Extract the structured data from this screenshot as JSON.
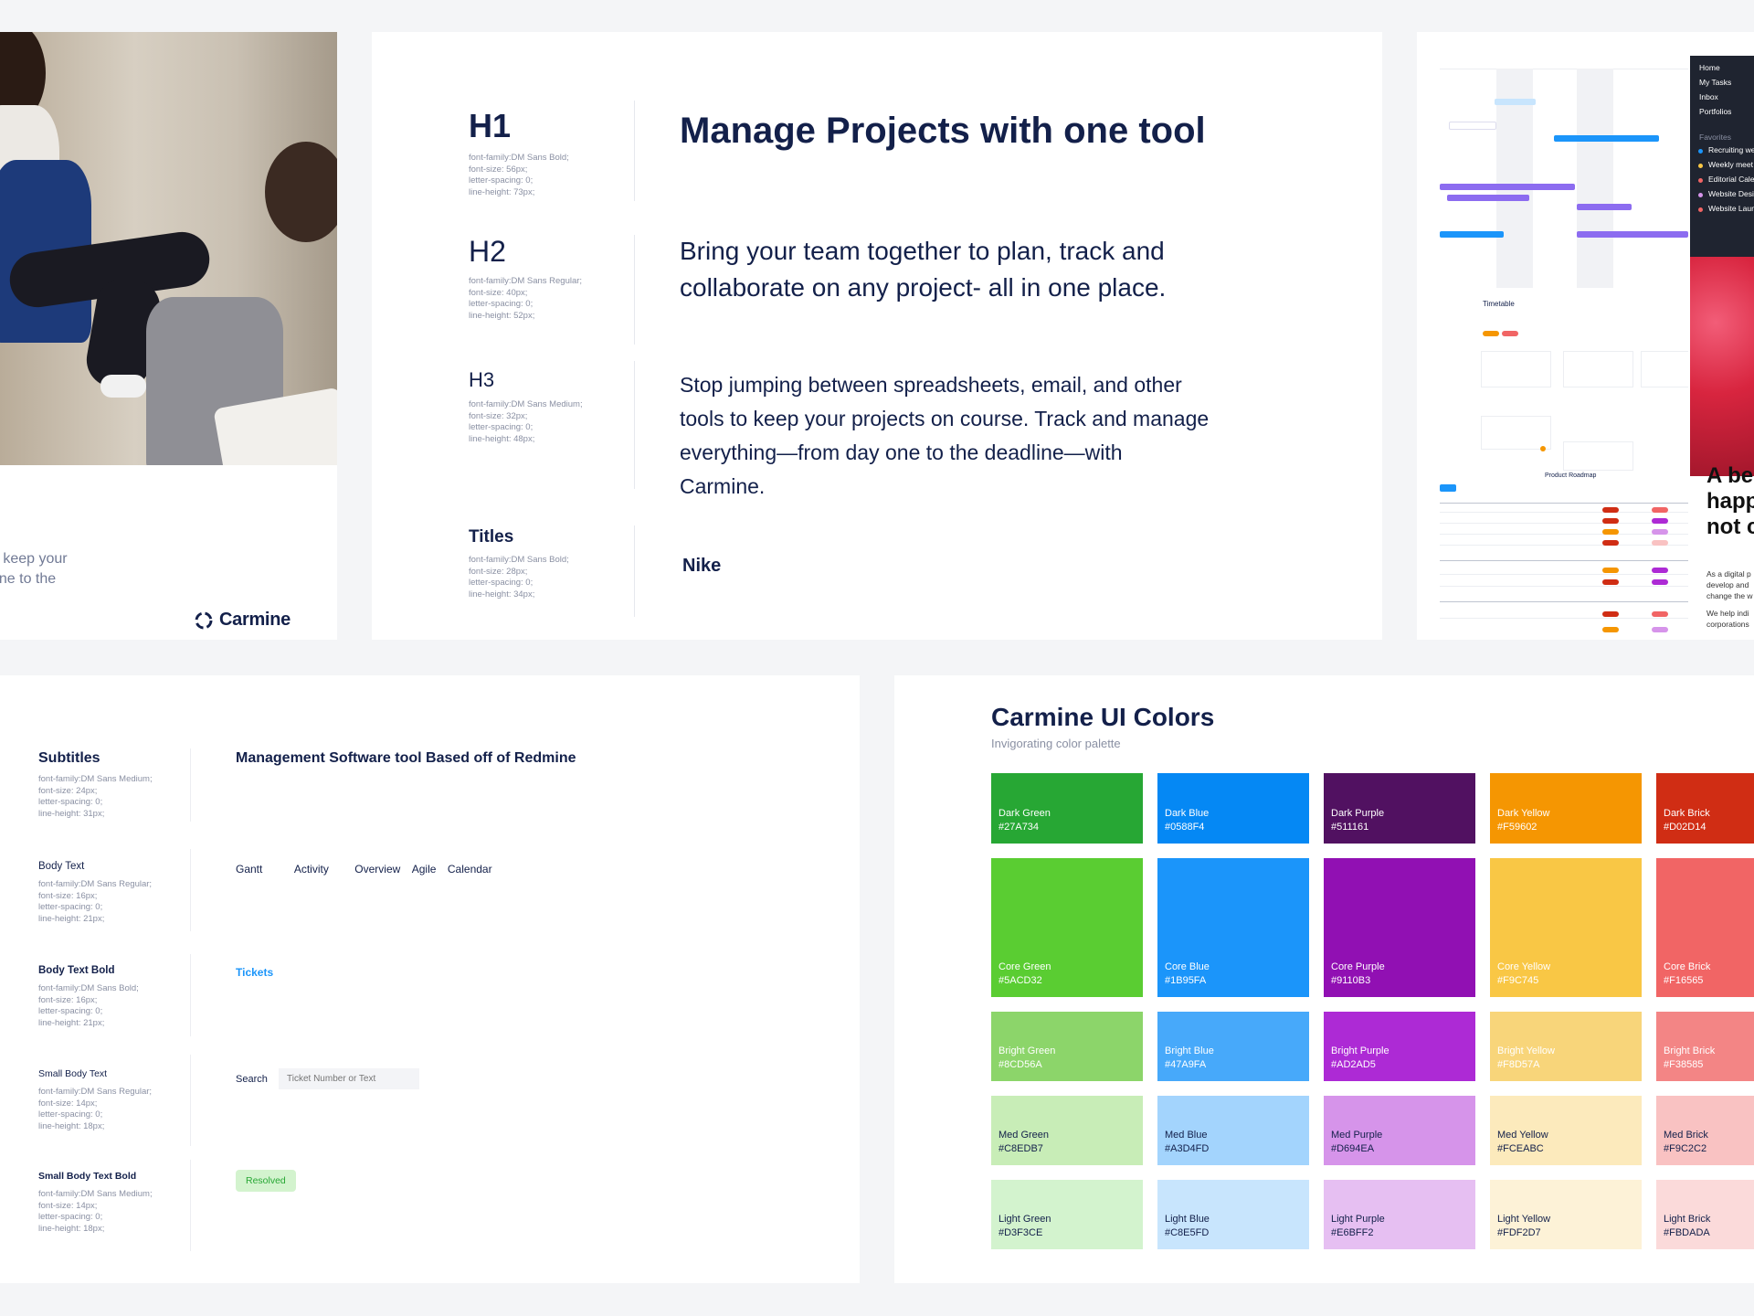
{
  "brand_card": {
    "tagline_lines": [
      "o keep your",
      "one to the"
    ],
    "brand_name": "Carmine"
  },
  "typography": {
    "styles": [
      {
        "label": "H1",
        "meta": [
          "font-family:DM Sans Bold;",
          "font-size: 56px;",
          "letter-spacing: 0;",
          "line-height: 73px;"
        ],
        "sample": "Manage Projects with one tool"
      },
      {
        "label": "H2",
        "meta": [
          "font-family:DM Sans Regular;",
          "font-size: 40px;",
          "letter-spacing: 0;",
          "line-height: 52px;"
        ],
        "sample": "Bring your team together to plan, track and collaborate on any project- all in one place."
      },
      {
        "label": "H3",
        "meta": [
          "font-family:DM Sans Medium;",
          "font-size: 32px;",
          "letter-spacing: 0;",
          "line-height: 48px;"
        ],
        "sample": "Stop jumping between spreadsheets, email, and other tools to keep your projects on course. Track and manage everything—from day one to the deadline—with Carmine."
      },
      {
        "label": "Titles",
        "meta": [
          "font-family:DM Sans Bold;",
          "font-size: 28px;",
          "letter-spacing: 0;",
          "line-height: 34px;"
        ],
        "sample": "Nike"
      }
    ]
  },
  "screens_card": {
    "nav_items": [
      "Home",
      "My Tasks",
      "Inbox",
      "Portfolios"
    ],
    "favorites_label": "Favorites",
    "favorites": [
      "Recruiting we",
      "Weekly meet",
      "Editorial Cale",
      "Website Desi",
      "Website Laun"
    ],
    "favorite_colors": [
      "#1b95fa",
      "#f9c745",
      "#f16565",
      "#d694ea",
      "#f16565"
    ],
    "timetable_title": "Timetable",
    "roadmap_title": "Product Roadmap",
    "headline_lines": [
      "A be",
      "happ",
      "not c"
    ],
    "body_lines": [
      "As a digital p",
      "develop and",
      "change the w",
      "We help indi",
      "corporations"
    ]
  },
  "specimens": {
    "subtitles": {
      "label": "Subtitles",
      "meta": [
        "font-family:DM Sans Medium;",
        "font-size: 24px;",
        "letter-spacing: 0;",
        "line-height: 31px;"
      ],
      "sample": "Management Software tool Based off of Redmine"
    },
    "body_text": {
      "label": "Body Text",
      "meta": [
        "font-family:DM Sans Regular;",
        "font-size: 16px;",
        "letter-spacing: 0;",
        "line-height: 21px;"
      ],
      "tabs": [
        "Gantt",
        "Activity",
        "Overview",
        "Agile",
        "Calendar"
      ]
    },
    "body_text_bold": {
      "label": "Body Text Bold",
      "meta": [
        "font-family:DM Sans Bold;",
        "font-size: 16px;",
        "letter-spacing: 0;",
        "line-height: 21px;"
      ],
      "link": "Tickets"
    },
    "small_body_text": {
      "label": "Small Body Text",
      "meta": [
        "font-family:DM Sans Regular;",
        "font-size: 14px;",
        "letter-spacing: 0;",
        "line-height: 18px;"
      ],
      "search_label": "Search",
      "search_placeholder": "Ticket Number or Text"
    },
    "small_body_text_bold": {
      "label": "Small Body Text Bold",
      "meta": [
        "font-family:DM Sans Medium;",
        "font-size: 14px;",
        "letter-spacing: 0;",
        "line-height: 18px;"
      ],
      "badge": "Resolved"
    }
  },
  "colors": {
    "title": "Carmine UI Colors",
    "subtitle": "Invigorating color palette",
    "columns": [
      [
        {
          "name": "Dark Green",
          "hex": "#27A734",
          "text": "#ffffff"
        },
        {
          "name": "Core Green",
          "hex": "#5ACD32",
          "text": "#ffffff"
        },
        {
          "name": "Bright Green",
          "hex": "#8CD56A",
          "text": "#ffffff"
        },
        {
          "name": "Med Green",
          "hex": "#C8EDB7",
          "text": "#13204a"
        },
        {
          "name": "Light Green",
          "hex": "#D3F3CE",
          "text": "#13204a"
        }
      ],
      [
        {
          "name": "Dark Blue",
          "hex": "#0588F4",
          "text": "#ffffff"
        },
        {
          "name": "Core Blue",
          "hex": "#1B95FA",
          "text": "#ffffff"
        },
        {
          "name": "Bright Blue",
          "hex": "#47A9FA",
          "text": "#ffffff"
        },
        {
          "name": "Med Blue",
          "hex": "#A3D4FD",
          "text": "#13204a"
        },
        {
          "name": "Light Blue",
          "hex": "#C8E5FD",
          "text": "#13204a"
        }
      ],
      [
        {
          "name": "Dark Purple",
          "hex": "#511161",
          "text": "#ffffff"
        },
        {
          "name": "Core Purple",
          "hex": "#9110B3",
          "text": "#ffffff"
        },
        {
          "name": "Bright Purple",
          "hex": "#AD2AD5",
          "text": "#ffffff"
        },
        {
          "name": "Med Purple",
          "hex": "#D694EA",
          "text": "#13204a"
        },
        {
          "name": "Light Purple",
          "hex": "#E6BFF2",
          "text": "#13204a"
        }
      ],
      [
        {
          "name": "Dark Yellow",
          "hex": "#F59602",
          "text": "#ffffff"
        },
        {
          "name": "Core Yellow",
          "hex": "#F9C745",
          "text": "#ffffff"
        },
        {
          "name": "Bright Yellow",
          "hex": "#F8D57A",
          "text": "#ffffff"
        },
        {
          "name": "Med Yellow",
          "hex": "#FCEABC",
          "text": "#13204a"
        },
        {
          "name": "Light Yellow",
          "hex": "#FDF2D7",
          "text": "#13204a"
        }
      ],
      [
        {
          "name": "Dark Brick",
          "hex": "#D02D14",
          "text": "#ffffff"
        },
        {
          "name": "Core Brick",
          "hex": "#F16565",
          "text": "#ffffff"
        },
        {
          "name": "Bright Brick",
          "hex": "#F38585",
          "text": "#ffffff"
        },
        {
          "name": "Med Brick",
          "hex": "#F9C2C2",
          "text": "#13204a"
        },
        {
          "name": "Light Brick",
          "hex": "#FBDADA",
          "text": "#13204a"
        }
      ]
    ]
  }
}
